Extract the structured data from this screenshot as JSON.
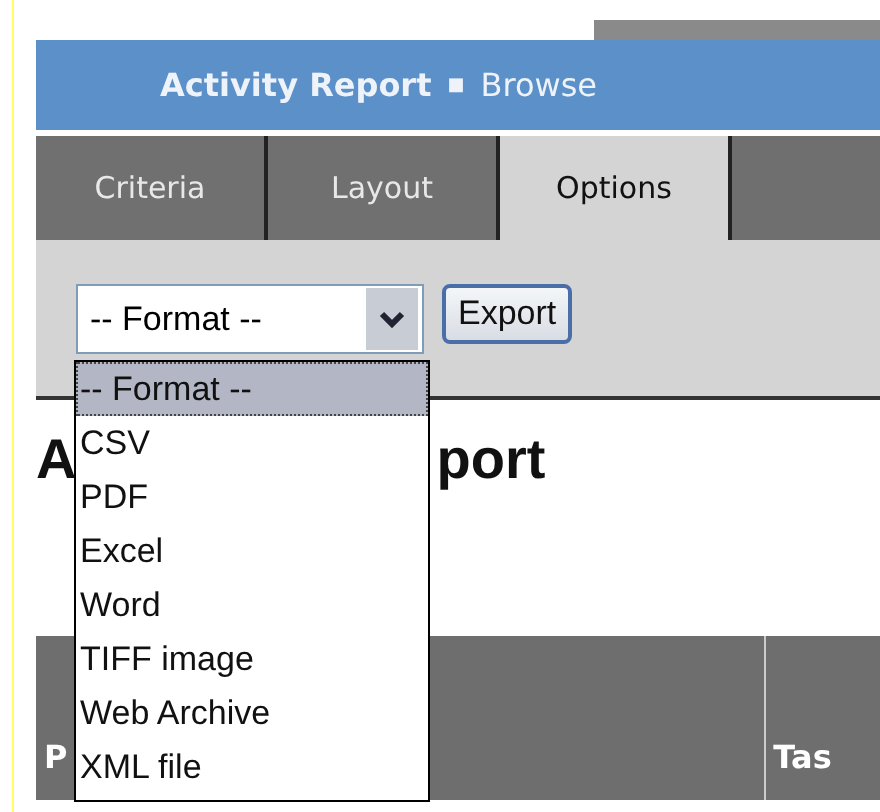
{
  "header": {
    "title": "Activity Report",
    "separator": "■",
    "subtitle": "Browse"
  },
  "tabs": [
    {
      "label": "Criteria",
      "selected": false
    },
    {
      "label": "Layout",
      "selected": false
    },
    {
      "label": "Options",
      "selected": true
    }
  ],
  "format_select": {
    "value": "-- Format --",
    "expanded": true,
    "options": [
      {
        "label": "-- Format --",
        "selected": true
      },
      {
        "label": "CSV",
        "selected": false
      },
      {
        "label": "PDF",
        "selected": false
      },
      {
        "label": "Excel",
        "selected": false
      },
      {
        "label": "Word",
        "selected": false
      },
      {
        "label": "TIFF image",
        "selected": false
      },
      {
        "label": "Web Archive",
        "selected": false
      },
      {
        "label": "XML file",
        "selected": false
      }
    ]
  },
  "export_button": "Export",
  "report_title": {
    "visible_start": "A",
    "visible_end": "port"
  },
  "table": {
    "columns": [
      "P",
      "Tas"
    ]
  }
}
